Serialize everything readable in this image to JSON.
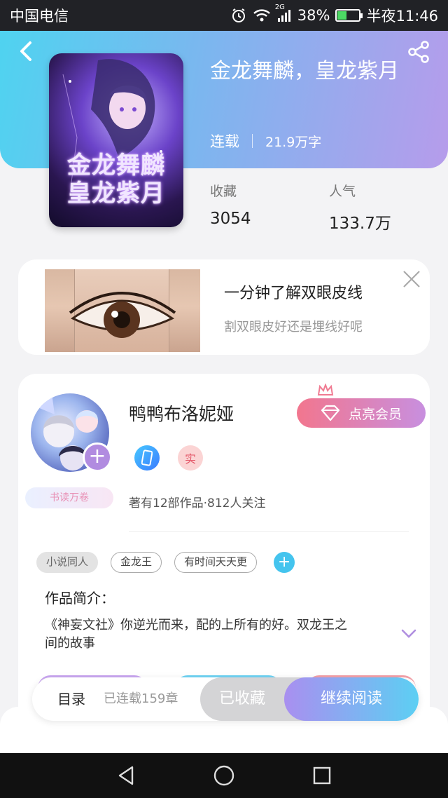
{
  "status_bar": {
    "carrier": "中国电信",
    "network": "2G",
    "battery": "38%",
    "battery_level": 0.38,
    "time": "半夜11:46"
  },
  "book": {
    "title": "金龙舞麟，皇龙紫月",
    "status": "连载",
    "word_count": "21.9万字",
    "stats": [
      {
        "label": "收藏",
        "value": "3054"
      },
      {
        "label": "人气",
        "value": "133.7万"
      }
    ],
    "cover_text_line1": "金龙舞麟",
    "cover_text_line2": "皇龙紫月"
  },
  "ad": {
    "title": "一分钟了解双眼皮线",
    "subtitle": "割双眼皮好还是埋线好呢"
  },
  "author": {
    "name": "鸭鸭布洛妮娅",
    "vip_label": "点亮会员",
    "real_badge": "实",
    "reader_badge": "书读万卷",
    "stats": "著有12部作品·812人关注"
  },
  "tags": [
    "小说同人",
    "金龙王",
    "有时间天天更"
  ],
  "intro": {
    "label": "作品简介：",
    "text": "《神妄文社》你逆光而来，配的上所有的好。双龙王之间的故事"
  },
  "action_bar": {
    "toc_label": "目录",
    "chapters": "已连载159章",
    "collected_label": "已收藏",
    "read_label": "继续阅读"
  },
  "colors": {
    "header_gradient_start": "#4fd3f0",
    "header_gradient_end": "#b69ceb",
    "vip_pink": "#f2768e",
    "accent_purple": "#a98ff0",
    "accent_cyan": "#5ccff3"
  },
  "icons": [
    "back-arrow-icon",
    "share-icon",
    "close-icon",
    "avatar-add-icon",
    "crown-icon",
    "diamond-icon",
    "phone-verified-icon",
    "chevron-down-icon",
    "nav-back-icon",
    "nav-home-icon",
    "nav-recents-icon"
  ]
}
